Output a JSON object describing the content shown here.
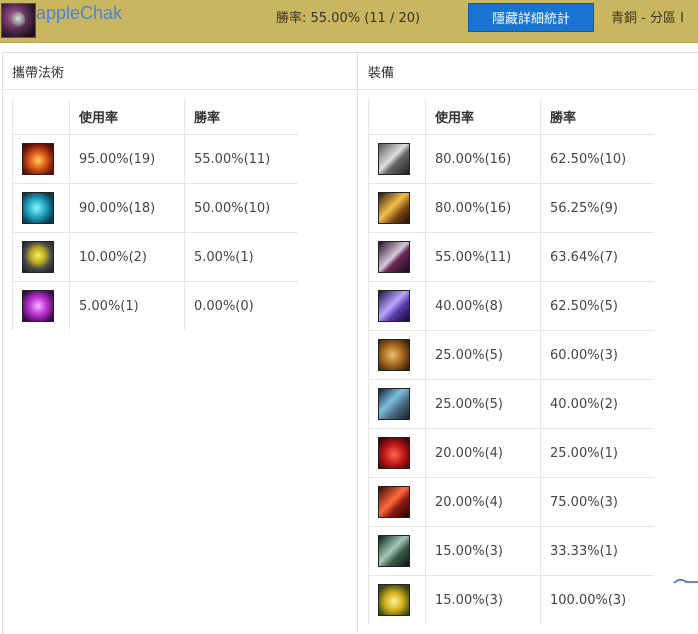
{
  "header": {
    "username": "appleChak",
    "winrate_text": "勝率: 55.00% (11 / 20)",
    "toggle_label": "隱藏詳細統計",
    "rank_text": "青銅 - 分區 I"
  },
  "spells": {
    "title": "攜帶法術",
    "columns": [
      "使用率",
      "勝率"
    ],
    "rows": [
      {
        "icon": "ignite-spell-icon",
        "use": "95.00%(19)",
        "win": "55.00%(11)"
      },
      {
        "icon": "ghost-spell-icon",
        "use": "90.00%(18)",
        "win": "50.00%(10)"
      },
      {
        "icon": "exhaust-spell-icon",
        "use": "10.00%(2)",
        "win": "5.00%(1)"
      },
      {
        "icon": "flash-spell-icon",
        "use": "5.00%(1)",
        "win": "0.00%(0)"
      }
    ]
  },
  "items": {
    "title": "裝備",
    "columns": [
      "使用率",
      "勝率"
    ],
    "rows": [
      {
        "icon": "armored-boots-icon",
        "use": "80.00%(16)",
        "win": "62.50%(10)"
      },
      {
        "icon": "golden-blade-icon",
        "use": "80.00%(16)",
        "win": "56.25%(9)"
      },
      {
        "icon": "long-sword-icon",
        "use": "55.00%(11)",
        "win": "63.64%(7)"
      },
      {
        "icon": "purple-sword-icon",
        "use": "40.00%(8)",
        "win": "62.50%(5)"
      },
      {
        "icon": "horn-dagger-icon",
        "use": "25.00%(5)",
        "win": "60.00%(3)"
      },
      {
        "icon": "gauntlet-icon",
        "use": "25.00%(5)",
        "win": "40.00%(2)"
      },
      {
        "icon": "red-potion-icon",
        "use": "20.00%(4)",
        "win": "25.00%(1)"
      },
      {
        "icon": "red-spear-icon",
        "use": "20.00%(4)",
        "win": "75.00%(3)"
      },
      {
        "icon": "axe-icon",
        "use": "15.00%(3)",
        "win": "33.33%(1)"
      },
      {
        "icon": "golden-emblem-icon",
        "use": "15.00%(3)",
        "win": "100.00%(3)"
      }
    ]
  }
}
